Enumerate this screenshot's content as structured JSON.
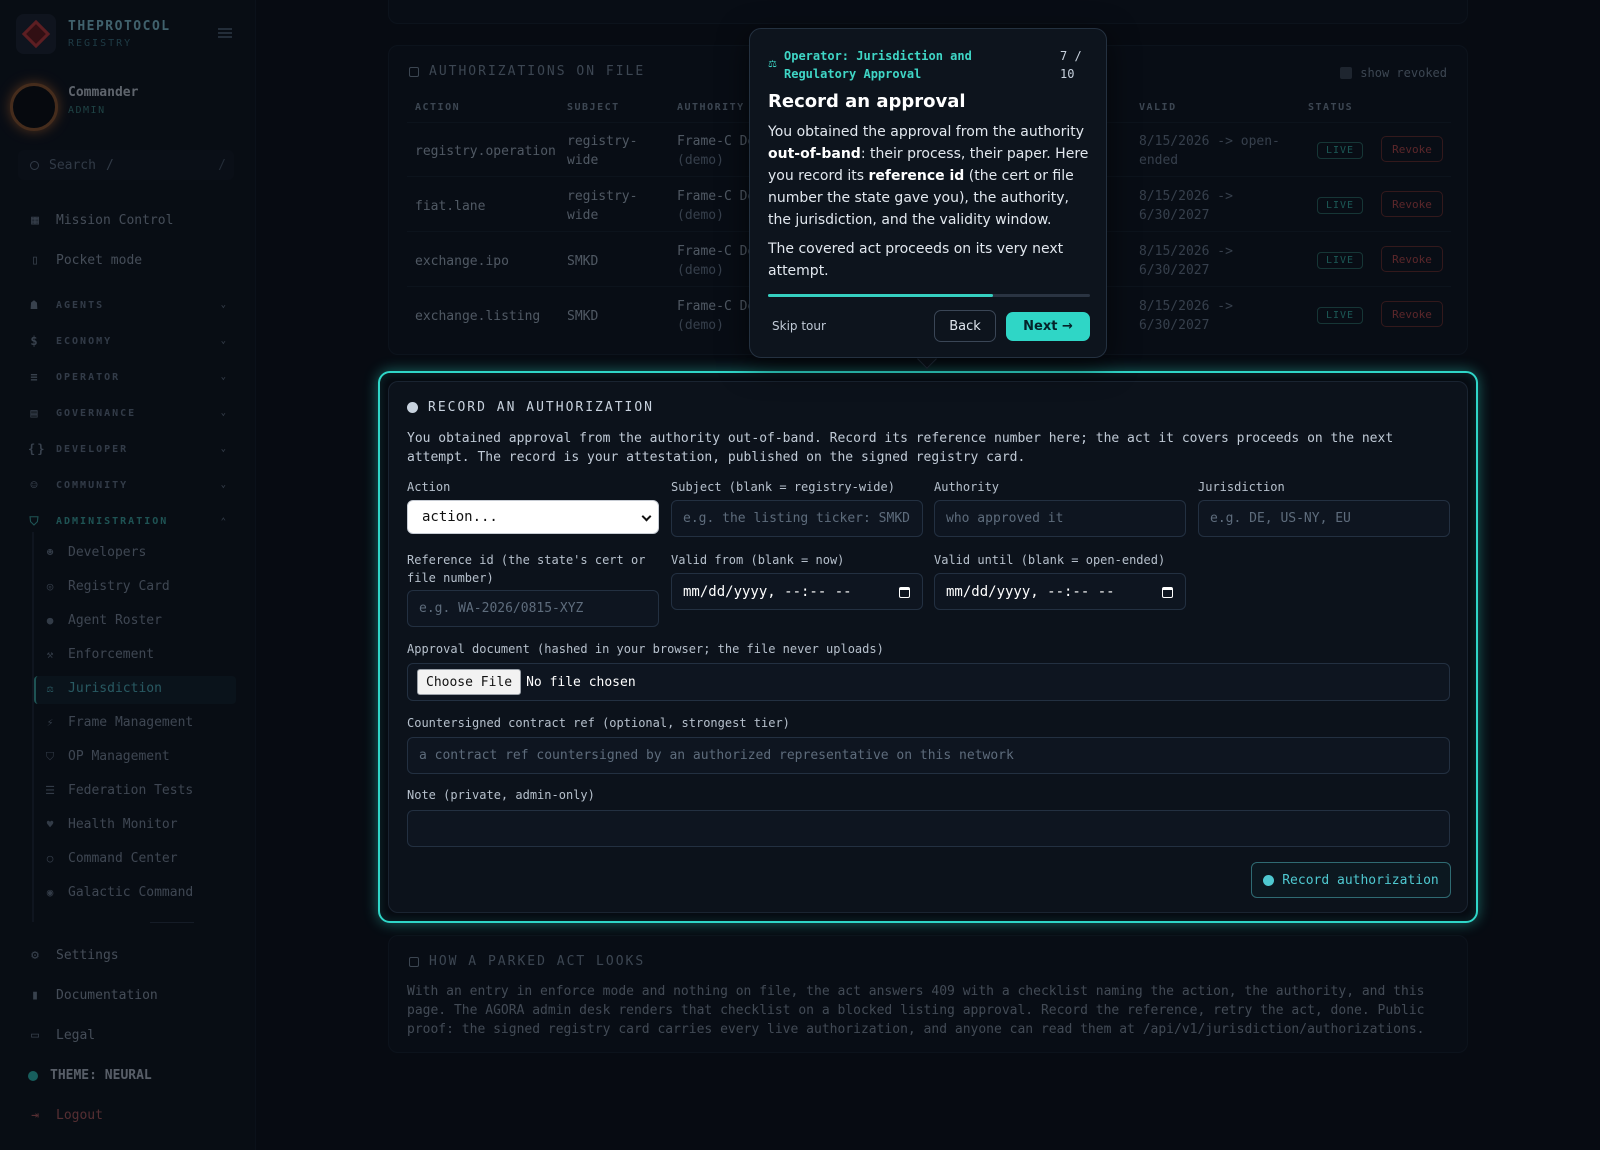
{
  "brand": {
    "title": "THEPROTOCOL",
    "subtitle": "REGISTRY"
  },
  "user": {
    "name": "Commander",
    "role": "ADMIN"
  },
  "search": {
    "placeholder": "Search",
    "shortcut": "/"
  },
  "nav": {
    "top": [
      {
        "label": "Mission Control",
        "icon": "grid-icon"
      },
      {
        "label": "Pocket mode",
        "icon": "phone-icon"
      }
    ],
    "sections": [
      {
        "label": "AGENTS",
        "icon": "robot-icon"
      },
      {
        "label": "ECONOMY",
        "icon": "dollar-icon"
      },
      {
        "label": "OPERATOR",
        "icon": "server-icon"
      },
      {
        "label": "GOVERNANCE",
        "icon": "table-icon"
      },
      {
        "label": "DEVELOPER",
        "icon": "code-icon"
      },
      {
        "label": "COMMUNITY",
        "icon": "people-icon"
      },
      {
        "label": "ADMINISTRATION",
        "icon": "shield-icon"
      }
    ],
    "admin_items": [
      {
        "label": "Developers",
        "icon": "user-plus-icon"
      },
      {
        "label": "Registry Card",
        "icon": "badge-icon"
      },
      {
        "label": "Agent Roster",
        "icon": "user-icon"
      },
      {
        "label": "Enforcement",
        "icon": "gavel-icon"
      },
      {
        "label": "Jurisdiction",
        "icon": "scale-icon"
      },
      {
        "label": "Frame Management",
        "icon": "frame-icon"
      },
      {
        "label": "OP Management",
        "icon": "shield-small-icon"
      },
      {
        "label": "Federation Tests",
        "icon": "list-icon"
      },
      {
        "label": "Health Monitor",
        "icon": "heart-icon"
      },
      {
        "label": "Command Center",
        "icon": "circle-icon"
      },
      {
        "label": "Galactic Command",
        "icon": "target-icon"
      }
    ],
    "bottom": [
      {
        "label": "Settings",
        "icon": "gear-icon"
      },
      {
        "label": "Documentation",
        "icon": "book-icon"
      },
      {
        "label": "Legal",
        "icon": "doc-icon"
      }
    ],
    "theme": "THEME: NEURAL",
    "logout": "Logout"
  },
  "authorizations": {
    "title": "AUTHORIZATIONS ON FILE",
    "show_revoked": "show revoked",
    "columns": {
      "action": "ACTION",
      "subject": "SUBJECT",
      "authority": "AUTHORITY",
      "valid": "VALID",
      "status": "STATUS"
    },
    "rows": [
      {
        "action": "registry.operation",
        "subject": "registry-\nwide",
        "authority": "Frame-C De",
        "authority_sub": "(demo)",
        "valid": "8/15/2026 -> open-\nended",
        "status": "LIVE",
        "revoke": "Revoke"
      },
      {
        "action": "fiat.lane",
        "subject": "registry-\nwide",
        "authority": "Frame-C De",
        "authority_sub": "(demo)",
        "valid": "8/15/2026 ->\n6/30/2027",
        "status": "LIVE",
        "revoke": "Revoke"
      },
      {
        "action": "exchange.ipo",
        "subject": "SMKD",
        "authority": "Frame-C De",
        "authority_sub": "(demo)",
        "valid": "8/15/2026 ->\n6/30/2027",
        "status": "LIVE",
        "revoke": "Revoke"
      },
      {
        "action": "exchange.listing",
        "subject": "SMKD",
        "authority": "Frame-C De",
        "authority_sub": "(demo)",
        "valid": "8/15/2026 ->\n6/30/2027",
        "status": "LIVE",
        "revoke": "Revoke"
      }
    ]
  },
  "record": {
    "title": "RECORD AN AUTHORIZATION",
    "description": "You obtained approval from the authority out-of-band. Record its reference number here; the act it covers proceeds on the next attempt. The record is your attestation, published on the signed registry card.",
    "fields": {
      "action": {
        "label": "Action",
        "value": "action..."
      },
      "subject": {
        "label": "Subject (blank = registry-wide)",
        "placeholder": "e.g. the listing ticker: SMKD"
      },
      "authority": {
        "label": "Authority",
        "placeholder": "who approved it"
      },
      "jurisdiction": {
        "label": "Jurisdiction",
        "placeholder": "e.g. DE, US-NY, EU"
      },
      "reference": {
        "label": "Reference id (the state's cert or file number)",
        "placeholder": "e.g. WA-2026/0815-XYZ"
      },
      "valid_from": {
        "label": "Valid from (blank = now)",
        "value": "mm/dd/yyyy, --:-- --"
      },
      "valid_until": {
        "label": "Valid until (blank = open-ended)",
        "value": "mm/dd/yyyy, --:-- --"
      },
      "document": {
        "label": "Approval document (hashed in your browser; the file never uploads)",
        "button": "Choose File",
        "status": "No file chosen"
      },
      "contract": {
        "label": "Countersigned contract ref (optional, strongest tier)",
        "placeholder": "a contract ref countersigned by an authorized representative on this network"
      },
      "note": {
        "label": "Note (private, admin-only)",
        "value": ""
      }
    },
    "submit": "Record authorization"
  },
  "parked": {
    "title": "HOW A PARKED ACT LOOKS",
    "text": "With an entry in enforce mode and nothing on file, the act answers 409 with a checklist naming the action, the authority, and this page. The AGORA admin desk renders that checklist on a blocked listing approval. Record the reference, retry the act, done. Public proof: the signed registry card carries every live authorization, and anyone can read them at /api/v1/jurisdiction/authorizations."
  },
  "tour": {
    "kicker": "Operator: Jurisdiction and Regulatory Approval",
    "step": "7 / 10",
    "progress": 0.7,
    "title": "Record an approval",
    "p1_a": "You obtained the approval from the authority ",
    "p1_b": "out-of-band",
    "p1_c": ": their process, their paper. Here you record its ",
    "p1_d": "reference id",
    "p1_e": " (the cert or file number the state gave you), the authority, the jurisdiction, and the validity window.",
    "p2": "The covered act proceeds on its very next attempt.",
    "skip": "Skip tour",
    "back": "Back",
    "next": "Next →"
  }
}
